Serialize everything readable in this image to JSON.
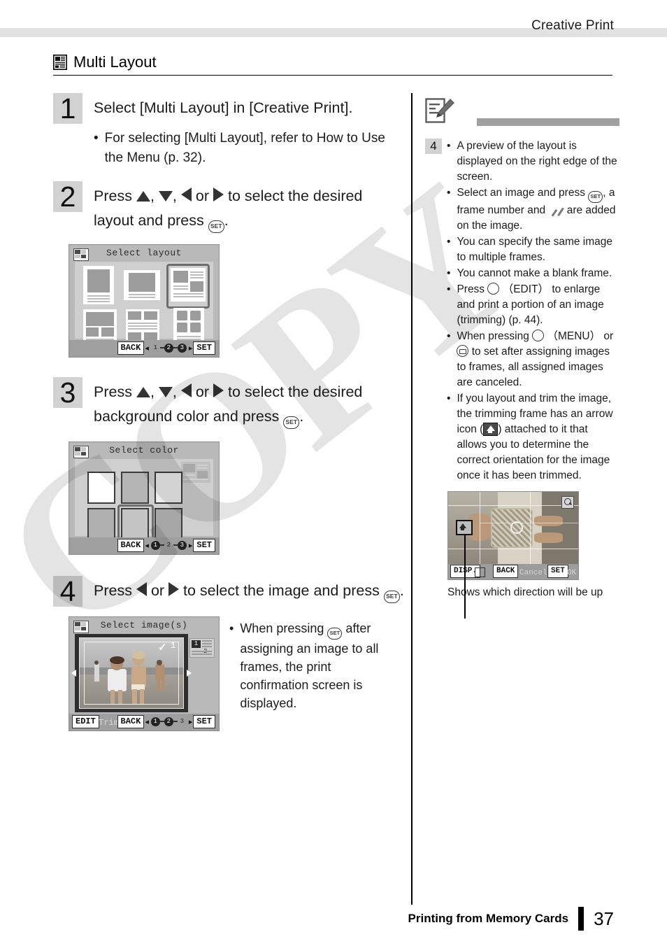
{
  "header": {
    "title": "Creative Print"
  },
  "section": {
    "icon": "multi-layout-icon",
    "title": "Multi Layout"
  },
  "steps": [
    {
      "num": "1",
      "text": "Select [Multi Layout] in [Creative Print].",
      "sub": [
        "For selecting [Multi Layout], refer to How to Use the Menu (p. 32)."
      ]
    },
    {
      "num": "2",
      "text_a": "Press",
      "text_b": ",",
      "text_c": ",",
      "text_d": "or",
      "text_e": "to select the desired layout and press",
      "text_f": "."
    },
    {
      "num": "3",
      "text_a": "Press",
      "text_b": ",",
      "text_c": ",",
      "text_d": "or",
      "text_e": "to select the desired background color and press",
      "text_f": "."
    },
    {
      "num": "4",
      "text_a": "Press",
      "text_d": "or",
      "text_e": "to select the image and press",
      "text_f": ".",
      "sub_a": "When pressing",
      "sub_b": "after assigning an image to all frames, the print confirmation screen is displayed."
    }
  ],
  "screens": {
    "layout": {
      "title": "Select layout",
      "back_label": "BACK",
      "set_label": "SET",
      "dots": [
        {
          "n": "1",
          "on": false
        },
        {
          "n": "2",
          "on": true
        },
        {
          "n": "3",
          "on": true
        }
      ]
    },
    "color": {
      "title": "Select color",
      "back_label": "BACK",
      "set_label": "SET",
      "dots": [
        {
          "n": "1",
          "on": true
        },
        {
          "n": "2",
          "on": false
        },
        {
          "n": "3",
          "on": true
        }
      ]
    },
    "image": {
      "title": "Select image(s)",
      "edit_label": "EDIT",
      "trimming_label": "Trimming",
      "back_label": "BACK",
      "set_label": "SET",
      "frame_check": "1",
      "thumb_1": "1",
      "thumb_2": "2",
      "dots": [
        {
          "n": "1",
          "on": true
        },
        {
          "n": "2",
          "on": true
        },
        {
          "n": "3",
          "on": false
        }
      ]
    },
    "trim": {
      "disp_label": "DISP.",
      "back_label": "BACK",
      "back_action": "Cancel",
      "set_label": "SET",
      "set_action": "OK"
    }
  },
  "notes": {
    "icon": "note-pencil-icon",
    "number": "4",
    "items": [
      {
        "text": "A preview of the layout is displayed on the right edge of the screen."
      },
      {
        "pre": "Select an image and press",
        "mid": ", a frame number and",
        "post": "are added on the image."
      },
      {
        "text": "You can specify the same image to multiple frames."
      },
      {
        "text": "You cannot make a blank frame."
      },
      {
        "pre": "Press",
        "mid": "（EDIT）",
        "post": "to enlarge and print a portion of an image (trimming) (p. 44)."
      },
      {
        "pre": "When pressing",
        "mid": "（MENU）",
        "post": "or",
        "post2": "to set after assigning images to frames, all assigned images are canceled."
      },
      {
        "pre": "If you layout and trim the image, the trimming frame has an arrow icon (",
        "post": ") attached to it that allows you to determine the correct orientation for the image once it has been trimmed."
      }
    ],
    "caption": "Shows which direction will be up"
  },
  "footer": {
    "text": "Printing from Memory Cards",
    "page": "37"
  },
  "watermark": {
    "text": "COPY"
  }
}
